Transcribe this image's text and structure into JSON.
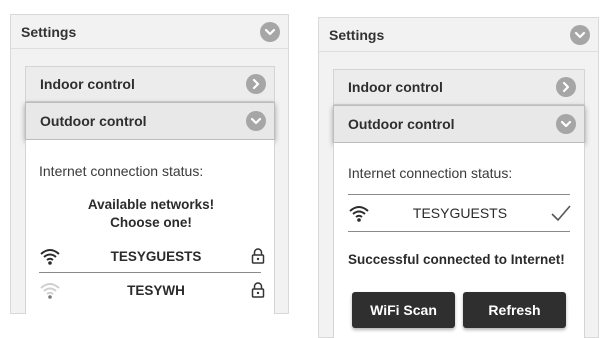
{
  "left_panel": {
    "title": "Settings",
    "indoor_label": "Indoor control",
    "outdoor_label": "Outdoor control",
    "status_label": "Internet connection status:",
    "networks_line1": "Available networks!",
    "networks_line2": "Choose one!",
    "networks": [
      {
        "name": "TESYGUESTS",
        "signal": "strong",
        "secured": true
      },
      {
        "name": "TESYWH",
        "signal": "weak",
        "secured": true
      }
    ]
  },
  "right_panel": {
    "title": "Settings",
    "indoor_label": "Indoor control",
    "outdoor_label": "Outdoor control",
    "status_label": "Internet connection status:",
    "connected_network": "TESYGUESTS",
    "success_message": "Successful connected to Internet!",
    "wifi_scan_label": "WiFi Scan",
    "refresh_label": "Refresh"
  },
  "icons": {
    "chevron": "chevron-down-icon",
    "chevron_right": "chevron-right-icon",
    "wifi": "wifi-icon",
    "lock": "lock-icon",
    "check": "checkmark-icon"
  },
  "colors": {
    "button_bg": "#2f2f2f",
    "chevron_bg": "#a6a6a6",
    "panel_bg": "#f2f2f2"
  }
}
